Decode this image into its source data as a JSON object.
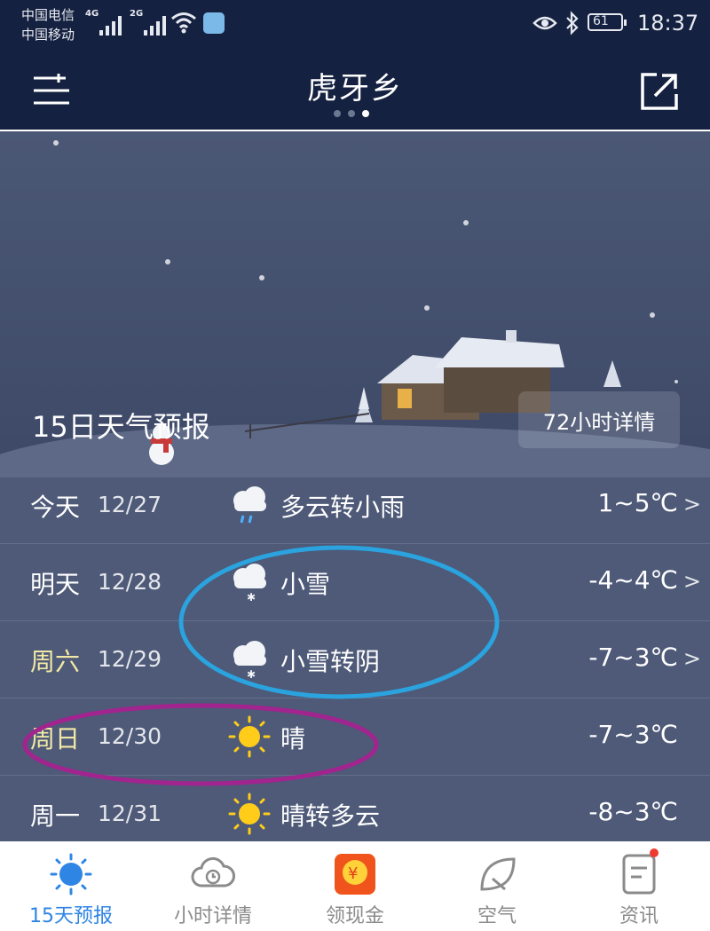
{
  "status_bar": {
    "carrier_1": "中国电信",
    "carrier_2": "中国移动",
    "network_1": "4G",
    "network_2": "2G",
    "battery": "61",
    "time": "18:37"
  },
  "header": {
    "title": "虎牙乡",
    "page_dots": 3,
    "active_dot": 3
  },
  "forecast": {
    "title": "15日天气预报",
    "hours_button": "72小时详情",
    "rows": [
      {
        "day": "今天",
        "date": "12/27",
        "icon": "cloud-rain-icon",
        "desc": "多云转小雨",
        "temp": "1~5℃",
        "chevron": ">"
      },
      {
        "day": "明天",
        "date": "12/28",
        "icon": "cloud-snow-icon",
        "desc": "小雪",
        "temp": "-4~4℃",
        "chevron": ">"
      },
      {
        "day": "周六",
        "date": "12/29",
        "icon": "cloud-snow-icon",
        "desc": "小雪转阴",
        "temp": "-7~3℃",
        "chevron": ">"
      },
      {
        "day": "周日",
        "date": "12/30",
        "icon": "sun-icon",
        "desc": "晴",
        "temp": "-7~3℃",
        "chevron": ""
      },
      {
        "day": "周一",
        "date": "12/31",
        "icon": "sun-icon",
        "desc": "晴转多云",
        "temp": "-8~3℃",
        "chevron": ""
      }
    ]
  },
  "bottom_nav": {
    "items": [
      {
        "label": "15天预报",
        "icon": "sun-icon",
        "active": true
      },
      {
        "label": "小时详情",
        "icon": "cloud-clock-icon",
        "active": false
      },
      {
        "label": "领现金",
        "icon": "cash-coin-icon",
        "active": false
      },
      {
        "label": "空气",
        "icon": "leaf-icon",
        "active": false
      },
      {
        "label": "资讯",
        "icon": "news-icon",
        "active": false,
        "badge": true
      }
    ]
  },
  "colors": {
    "header_bg": "#152140",
    "accent": "#2f85e4",
    "weekend": "#f3e9a6",
    "badge": "#ee3b30",
    "annotation_blue": "#2aa3df",
    "annotation_purple": "#a1248f"
  }
}
